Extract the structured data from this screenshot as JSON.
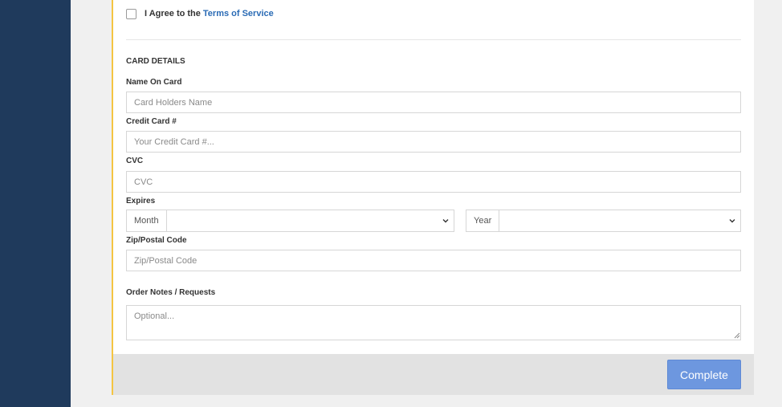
{
  "agreement": {
    "prefix": "I Agree to the",
    "link_text": "Terms of Service"
  },
  "card_details": {
    "section_title": "CARD DETAILS",
    "name_on_card": {
      "label": "Name On Card",
      "placeholder": "Card Holders Name",
      "value": ""
    },
    "credit_card": {
      "label": "Credit Card #",
      "placeholder": "Your Credit Card #...",
      "value": ""
    },
    "cvc": {
      "label": "CVC",
      "placeholder": "CVC",
      "value": ""
    },
    "expires": {
      "label": "Expires",
      "month_addon": "Month",
      "month_value": "",
      "year_addon": "Year",
      "year_value": ""
    },
    "zip": {
      "label": "Zip/Postal Code",
      "placeholder": "Zip/Postal Code",
      "value": ""
    }
  },
  "order_notes": {
    "label": "Order Notes / Requests",
    "placeholder": "Optional..."
  },
  "footer": {
    "complete_label": "Complete"
  },
  "colors": {
    "sidebar": "#1f3a5c",
    "accent_border": "#f4c542",
    "link": "#2a6bb5",
    "button": "#6d97df"
  },
  "icons": {
    "select_arrow": "chevron-down-icon",
    "textarea_grip": "resize-grip-icon"
  }
}
